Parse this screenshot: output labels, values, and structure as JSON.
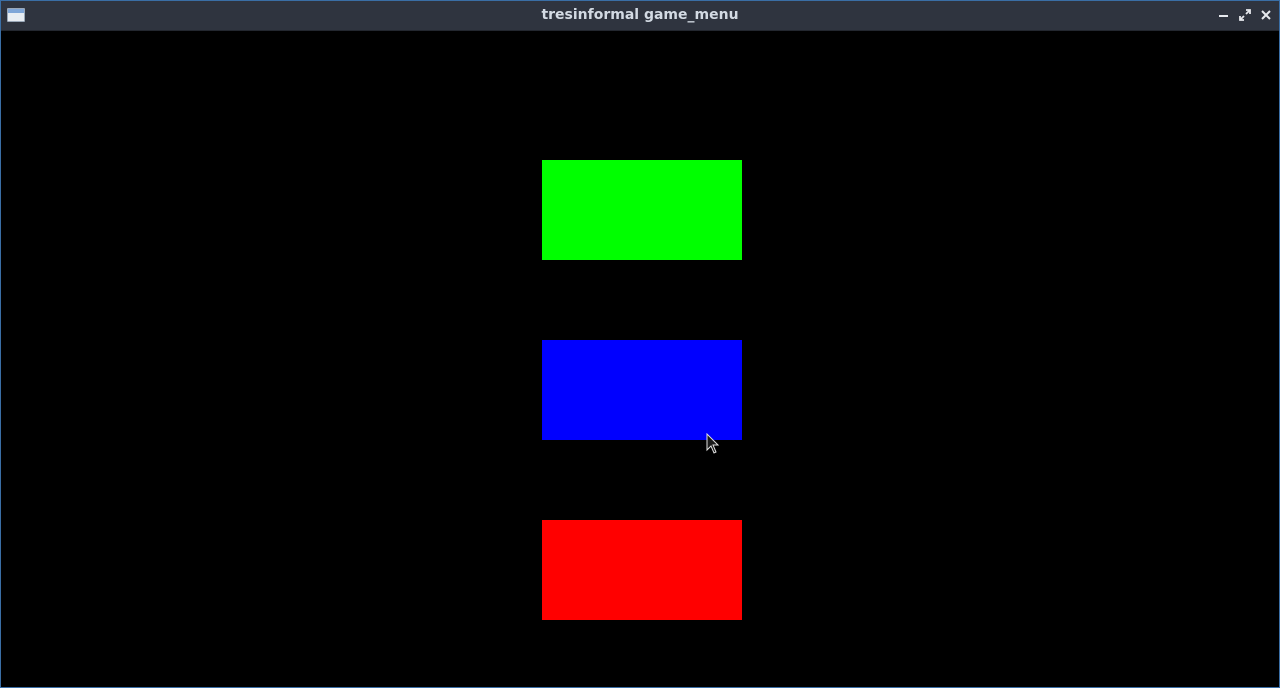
{
  "window": {
    "title": "tresinformal game_menu",
    "icons": {
      "app": "window-icon",
      "minimize": "minimize-icon",
      "maximize": "maximize-icon",
      "close": "close-icon"
    }
  },
  "menu": {
    "background": "#000000",
    "buttons": [
      {
        "name": "green-menu-button",
        "color": "#00ff00"
      },
      {
        "name": "blue-menu-button",
        "color": "#0000ff"
      },
      {
        "name": "red-menu-button",
        "color": "#ff0000"
      }
    ]
  }
}
